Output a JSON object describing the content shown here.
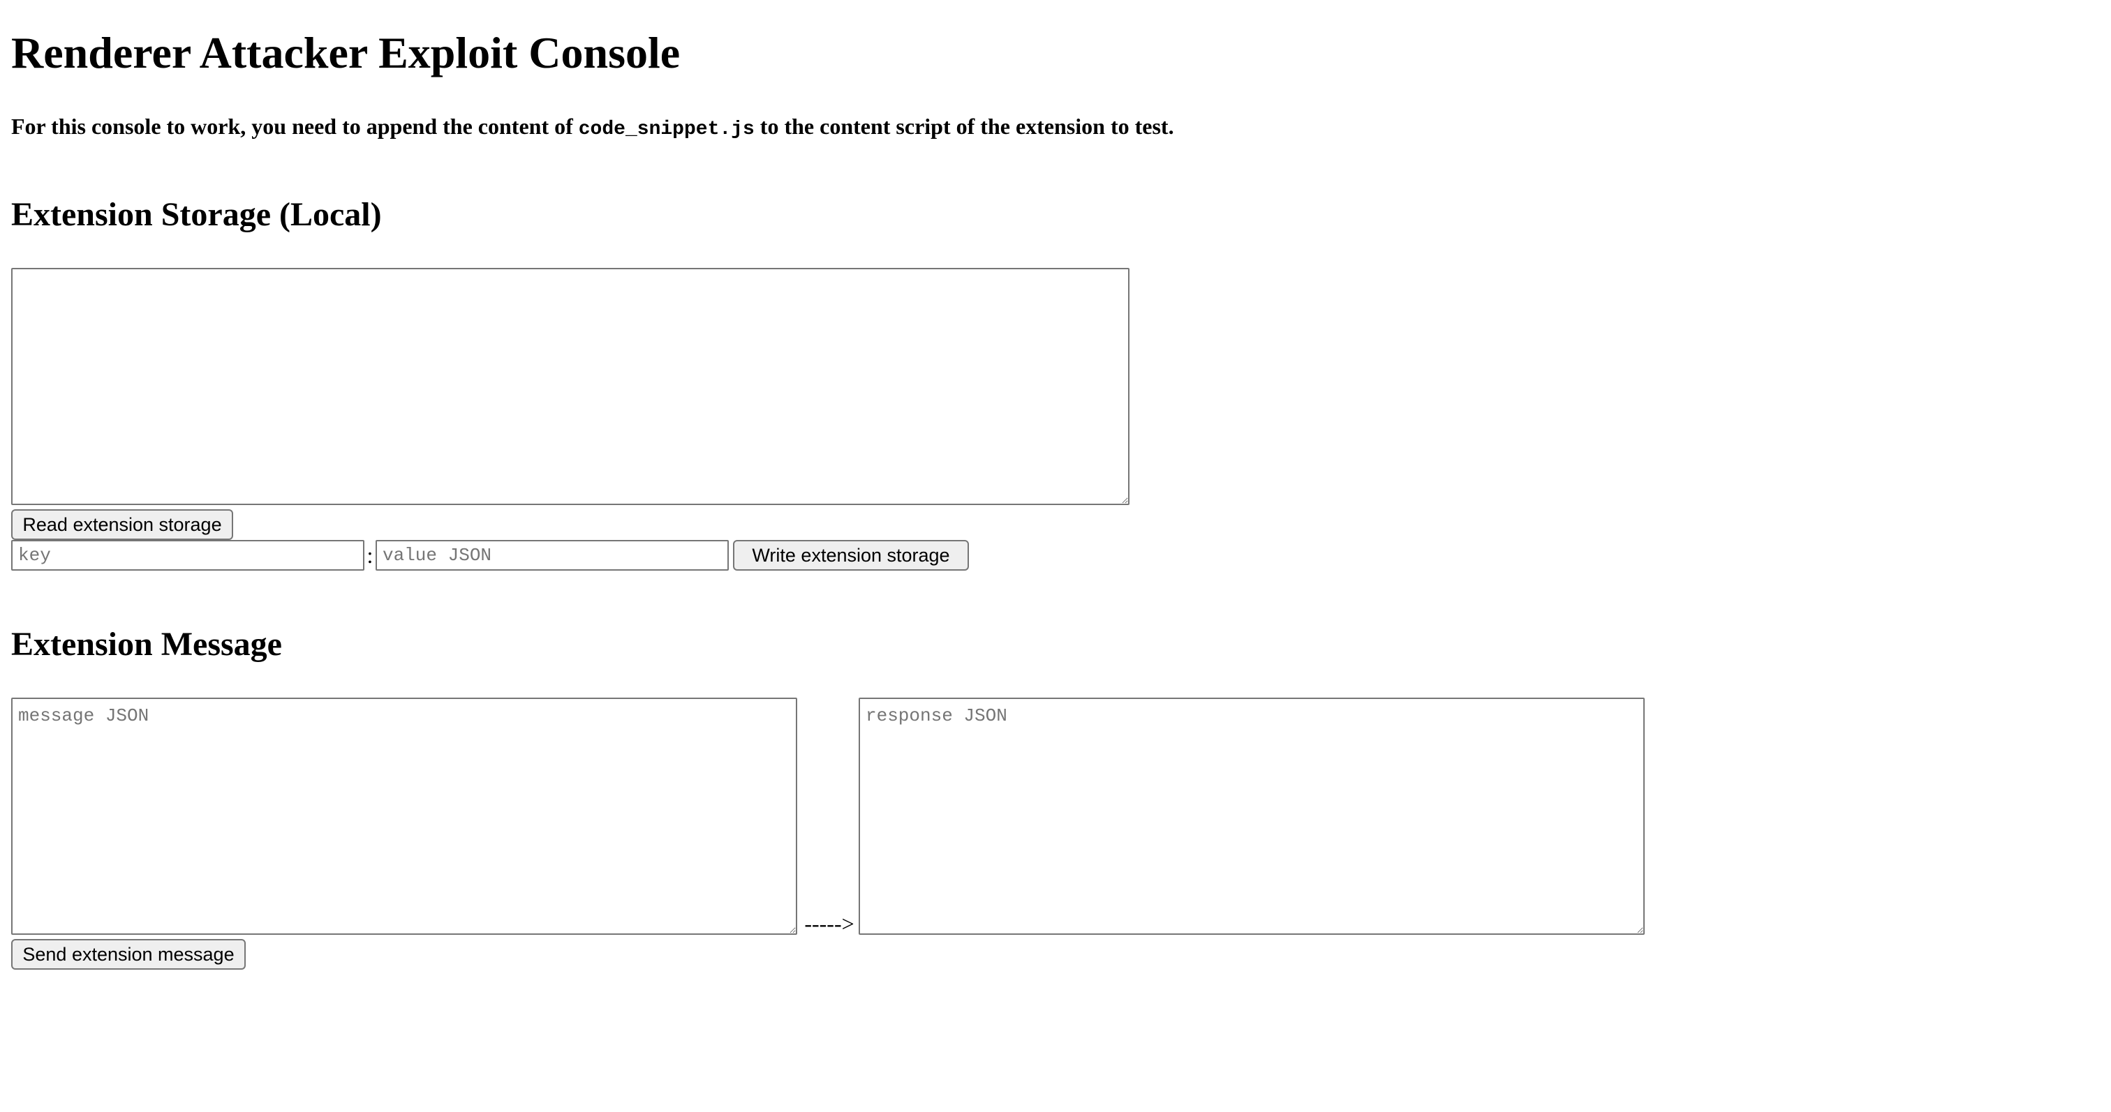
{
  "page": {
    "title": "Renderer Attacker Exploit Console",
    "intro": {
      "before": "For this console to work, you need to append the content of ",
      "code": "code_snippet.js",
      "after": " to the content script of the extension to test."
    }
  },
  "storage": {
    "heading": "Extension Storage (Local)",
    "textarea_value": "",
    "read_button": "Read extension storage",
    "key_placeholder": "key",
    "separator": ":",
    "value_placeholder": "value JSON",
    "write_button": "Write extension storage"
  },
  "message": {
    "heading": "Extension Message",
    "message_placeholder": "message JSON",
    "arrow": "----->",
    "response_placeholder": "response JSON",
    "send_button": "Send extension message"
  }
}
